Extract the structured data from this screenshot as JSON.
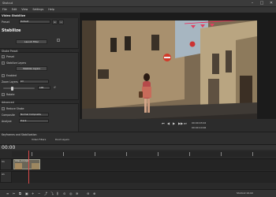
{
  "window": {
    "title": "Shotcut",
    "subtitle": ""
  },
  "menu": [
    "File",
    "Edit",
    "View",
    "Settings",
    "Help"
  ],
  "filter_panel": {
    "title": "Video Stabilize",
    "preset_label": "Preset",
    "preset_value": "Default",
    "plugin_title": "Stabilize",
    "launch_button": "Launch Filter",
    "settings": [
      {
        "label": "Shake Preset",
        "value": ""
      },
      {
        "label": "Preset",
        "value": "Default"
      },
      {
        "label": "Stabilize Layers",
        "value": ""
      },
      {
        "label": "Enabled",
        "value": ""
      },
      {
        "label": "Zoom Layers",
        "value": "All"
      },
      {
        "label": "Rotate",
        "value": ""
      }
    ],
    "slider_value": "100",
    "section_advanced": "Advanced",
    "section_presets": "Reduce Shake",
    "composite_label": "Composite",
    "composite_value": "Normal Composite",
    "analyze_label": "Analyze",
    "analyze_value": "Track"
  },
  "preview": {
    "sign_text": "",
    "timecode": "00:00:03:02",
    "duration": "00:00:10:06",
    "player_buttons": [
      "⏮",
      "◀",
      "▶",
      "▶▶",
      "⏭",
      "⏸"
    ]
  },
  "keyframes": {
    "title": "Keyframes and Stabilization",
    "items": [
      "Video Filters",
      "Dust Layers"
    ]
  },
  "timeline": {
    "timecode": "00:00",
    "track_labels": [
      "V1",
      "A1"
    ],
    "clip_label": "Video_12.mp4"
  },
  "status": {
    "right_text": "Shotcut 24.02"
  },
  "colors": {
    "accent": "#4a90d9",
    "sky": "#9fb2bf",
    "building": "#a98a66",
    "playhead": "#d94a4a"
  }
}
